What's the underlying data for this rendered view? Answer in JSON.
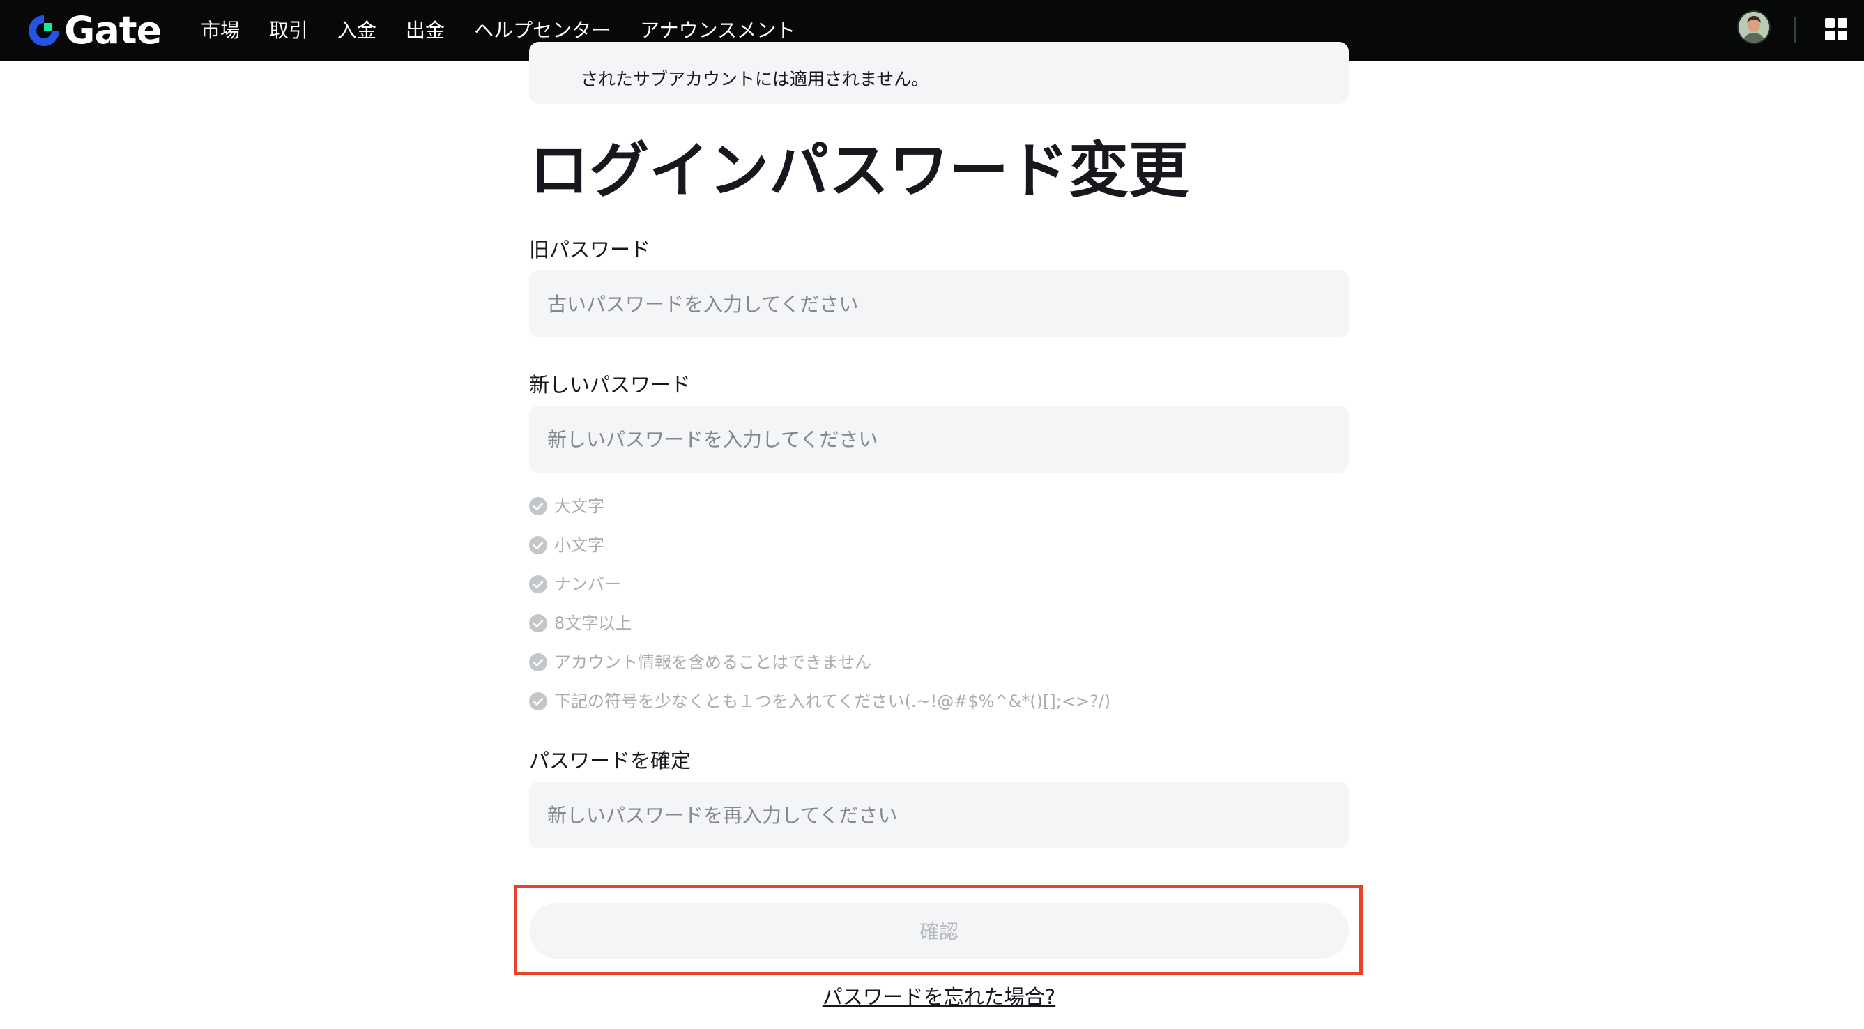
{
  "header": {
    "brand": "Gate",
    "nav": [
      "市場",
      "取引",
      "入金",
      "出金",
      "ヘルプセンター",
      "アナウンスメント"
    ],
    "brand_color": "#2354e6",
    "brand_accent": "#17e6a1",
    "icons": [
      "gate-logo-icon",
      "avatar",
      "apps-grid-icon"
    ]
  },
  "notice": {
    "text": "されたサブアカウントには適用されません。"
  },
  "title": "ログインパスワード変更",
  "form": {
    "old_password": {
      "label": "旧パスワード",
      "placeholder": "古いパスワードを入力してください",
      "value": ""
    },
    "new_password": {
      "label": "新しいパスワード",
      "placeholder": "新しいパスワードを入力してください",
      "value": ""
    },
    "rules": [
      "大文字",
      "小文字",
      "ナンバー",
      "8文字以上",
      "アカウント情報を含めることはできません",
      "下記の符号を少なくとも１つを入れてください(.~!@#$%^&*()[];<>?/)"
    ],
    "confirm_password": {
      "label": "パスワードを確定",
      "placeholder": "新しいパスワードを再入力してください",
      "value": ""
    },
    "submit_label": "確認",
    "forgot_label": "パスワードを忘れた場合?"
  },
  "colors": {
    "highlight": "#e8402b",
    "field_bg": "#f4f5f6",
    "rule_check": "#c4c7ca"
  }
}
